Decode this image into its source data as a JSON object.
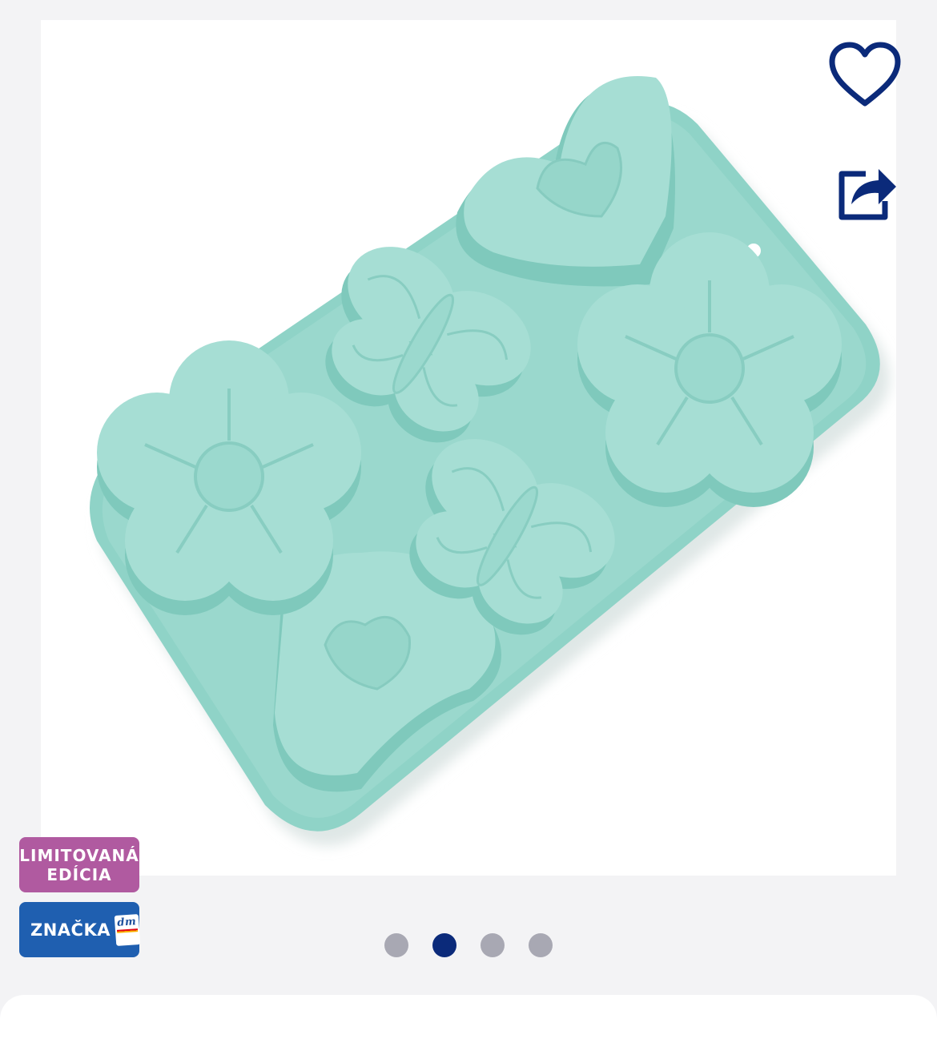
{
  "product": {
    "image_alt": "Silicone baking mold with heart, flower and butterfly shapes",
    "image_colors": {
      "mold": "#8fd3c7",
      "mold_light": "#a6ded4",
      "mold_shadow": "#6fbfb2"
    }
  },
  "actions": {
    "favorite_icon": "heart-outline-icon",
    "share_icon": "share-icon",
    "icon_color": "#0b2a7a"
  },
  "badges": {
    "limited_line1": "LIMITOVANÁ",
    "limited_line2": "EDÍCIA",
    "limited_color": "#b05aa0",
    "brand_label": "ZNAČKA",
    "brand_logo_text": "dm",
    "brand_color": "#1f5fb0"
  },
  "carousel": {
    "slide_count": 4,
    "active_index": 1,
    "active_color": "#0b2a7a",
    "inactive_color": "#a8a8b3"
  }
}
